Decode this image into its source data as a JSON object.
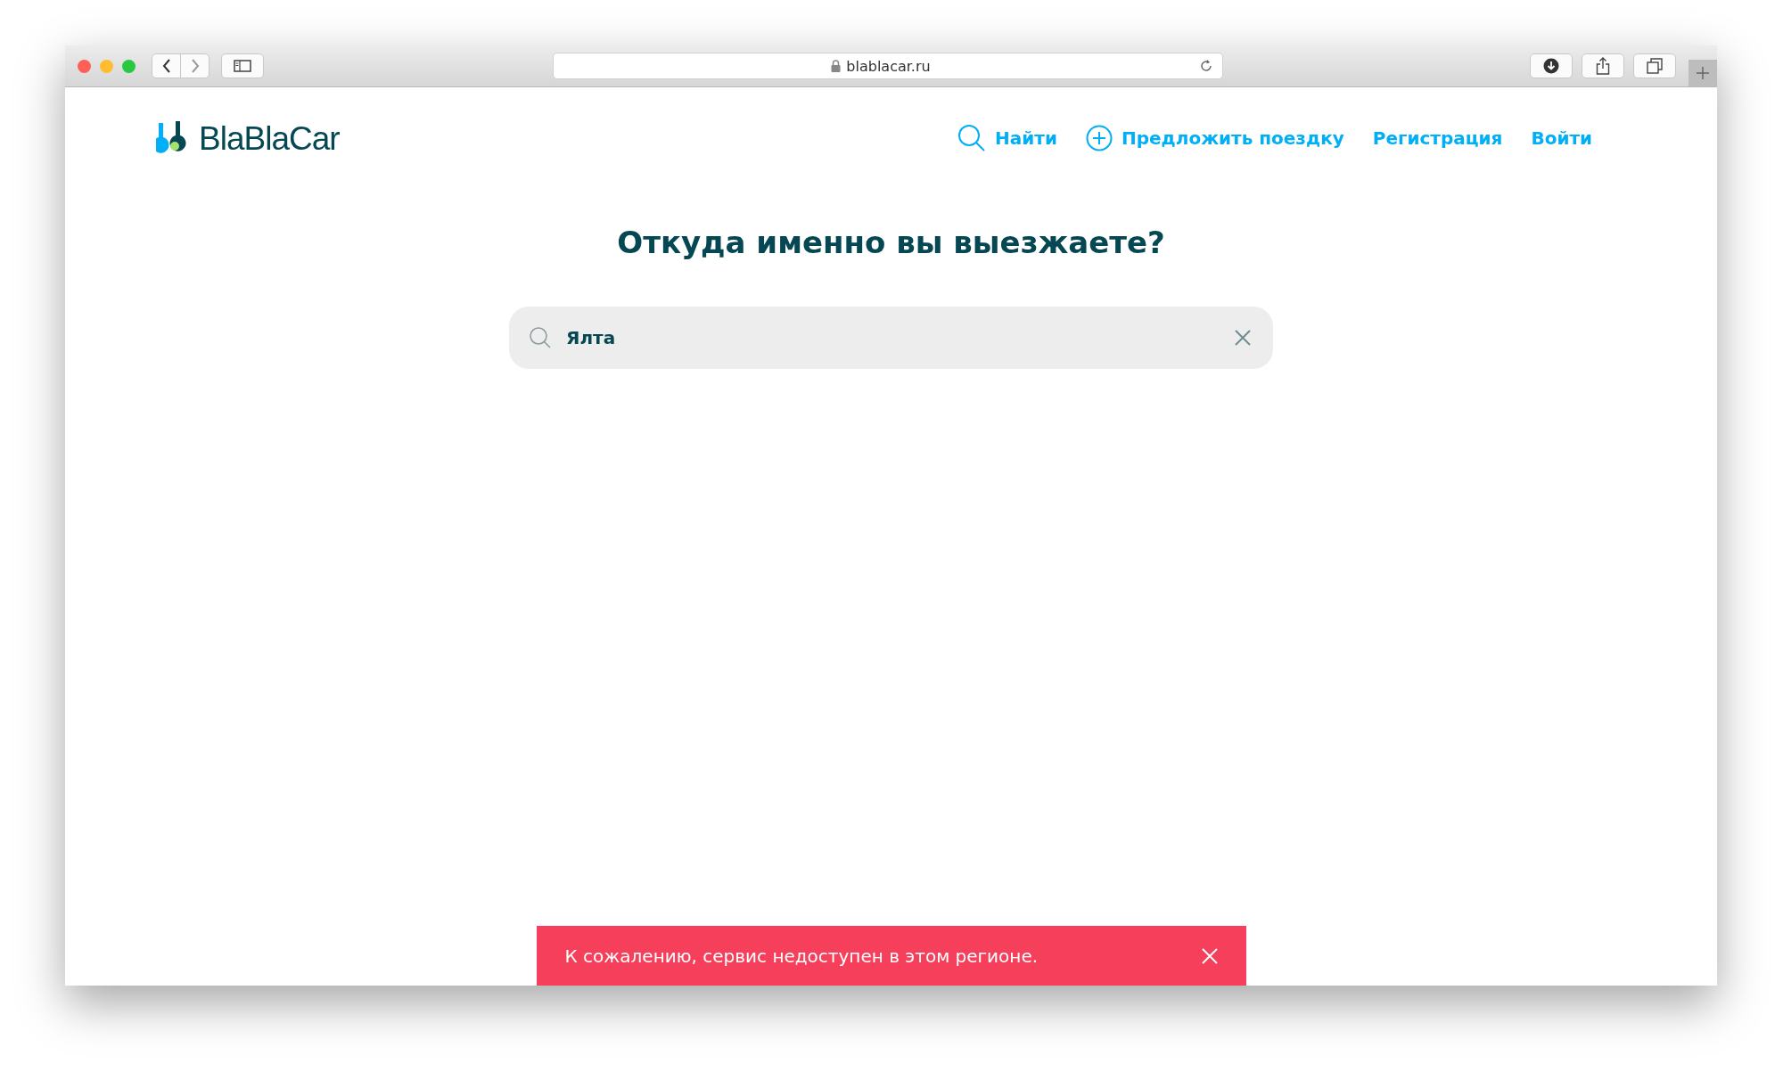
{
  "browser": {
    "url": "blablacar.ru"
  },
  "header": {
    "logo": "BlaBlaCar",
    "nav": [
      {
        "label": "Найти",
        "kind": "search"
      },
      {
        "label": "Предложить поездку",
        "kind": "offer"
      },
      {
        "label": "Регистрация",
        "kind": "link"
      },
      {
        "label": "Войти",
        "kind": "link"
      }
    ]
  },
  "heading": "Откуда именно вы выезжаете?",
  "search": {
    "value": "Ялта"
  },
  "toast": {
    "message": "К сожалению, сервис недоступен в этом регионе."
  }
}
